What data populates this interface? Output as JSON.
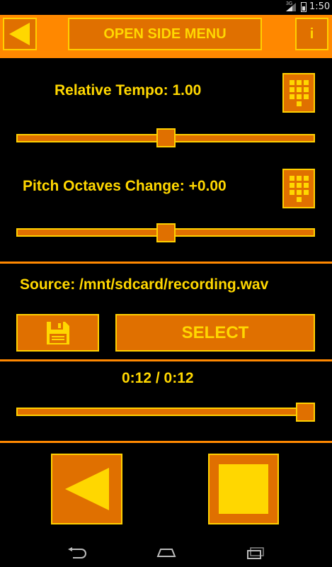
{
  "status_bar": {
    "network": "3G",
    "time": "1:50"
  },
  "top_bar": {
    "menu_label": "OPEN SIDE MENU",
    "info_label": "i"
  },
  "tempo": {
    "label": "Relative Tempo: 1.00",
    "slider_fraction": 0.5
  },
  "pitch": {
    "label": "Pitch Octaves Change: +0.00",
    "slider_fraction": 0.5
  },
  "source": {
    "label": "Source: /mnt/sdcard/recording.wav",
    "select_label": "SELECT"
  },
  "playback": {
    "time_label": "0:12 / 0:12",
    "progress_fraction": 1.0
  },
  "colors": {
    "accent": "#ff8800",
    "button_fill": "#e07000",
    "text": "#ffd700",
    "background": "#000000"
  }
}
